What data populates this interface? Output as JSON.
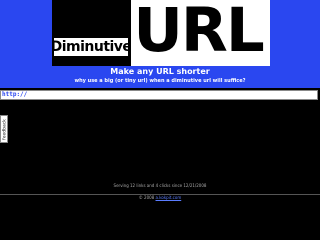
{
  "logo": {
    "small_text": "Diminutive",
    "big_text": "URL"
  },
  "tagline": {
    "title": "Make any URL shorter",
    "subtitle": "why use a big (or tiny url) when a diminutive url will suffice?"
  },
  "url_input": {
    "value": "http://"
  },
  "feedback_tab": {
    "label": "feedback"
  },
  "footer": {
    "stats": "Serving 12 links and 4 clicks since 12/21/2008",
    "copyright_prefix": "© 2008",
    "copyright_link": "a.kokpit.com"
  },
  "colors": {
    "brand_blue": "#2a47f0",
    "background": "#000000",
    "link_blue": "#5a7cff"
  }
}
